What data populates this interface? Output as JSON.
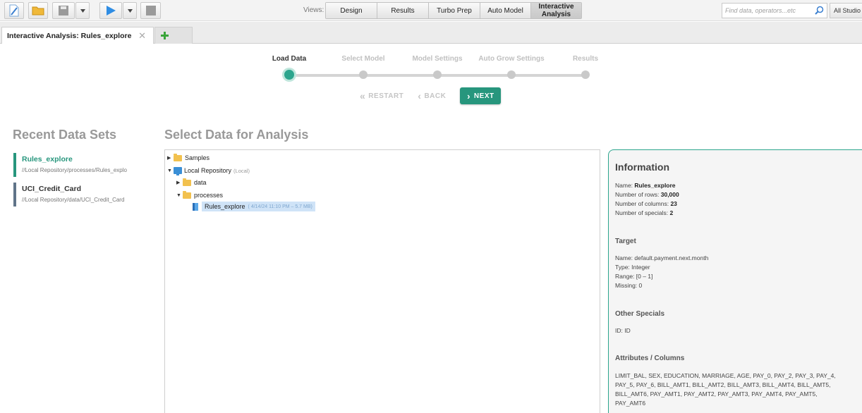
{
  "toolbar": {
    "views_label": "Views:",
    "views": [
      {
        "label": "Design",
        "active": false
      },
      {
        "label": "Results",
        "active": false
      },
      {
        "label": "Turbo Prep",
        "active": false
      },
      {
        "label": "Auto Model",
        "active": false
      },
      {
        "label": "Interactive Analysis",
        "active": true
      }
    ],
    "search_placeholder": "Find data, operators...etc",
    "studio_label": "All Studio"
  },
  "tab": {
    "title": "Interactive Analysis: Rules_explore",
    "close": "✕"
  },
  "steps": [
    {
      "label": "Load Data",
      "active": true
    },
    {
      "label": "Select Model",
      "active": false
    },
    {
      "label": "Model Settings",
      "active": false
    },
    {
      "label": "Auto Grow Settings",
      "active": false
    },
    {
      "label": "Results",
      "active": false
    }
  ],
  "nav": {
    "restart": "RESTART",
    "back": "BACK",
    "next": "NEXT"
  },
  "recent": {
    "title": "Recent Data Sets",
    "items": [
      {
        "name": "Rules_explore",
        "path": "//Local Repository/processes/Rules_explo"
      },
      {
        "name": "UCI_Credit_Card",
        "path": "//Local Repository/data/UCI_Credit_Card"
      }
    ]
  },
  "select": {
    "title": "Select Data for Analysis",
    "tree": {
      "samples": "Samples",
      "local_repo": "Local Repository",
      "local_tag": "(Local)",
      "data": "data",
      "processes": "processes",
      "selected_item": "Rules_explore",
      "selected_meta": "( 4/14/24 11:10 PM – 5.7 MB)"
    }
  },
  "info": {
    "title": "Information",
    "name_label": "Name:",
    "name": "Rules_explore",
    "rows_label": "Number of rows:",
    "rows": "30,000",
    "cols_label": "Number of columns:",
    "cols": "23",
    "specials_label": "Number of specials:",
    "specials": "2",
    "target_title": "Target",
    "target_name": "Name: default.payment.next.month",
    "target_type": "Type: Integer",
    "target_range": "Range: [0  –  1]",
    "target_missing": "Missing: 0",
    "other_title": "Other Specials",
    "other_id": "ID: ID",
    "attr_title": "Attributes / Columns",
    "attr_list": "LIMIT_BAL, SEX, EDUCATION, MARRIAGE, AGE, PAY_0, PAY_2, PAY_3, PAY_4, PAY_5, PAY_6, BILL_AMT1, BILL_AMT2, BILL_AMT3, BILL_AMT4, BILL_AMT5, BILL_AMT6, PAY_AMT1, PAY_AMT2, PAY_AMT3, PAY_AMT4, PAY_AMT5, PAY_AMT6"
  },
  "colors": {
    "accent": "#27967d",
    "selected_bg": "#cfe3f7",
    "border_alt": "#607489"
  }
}
